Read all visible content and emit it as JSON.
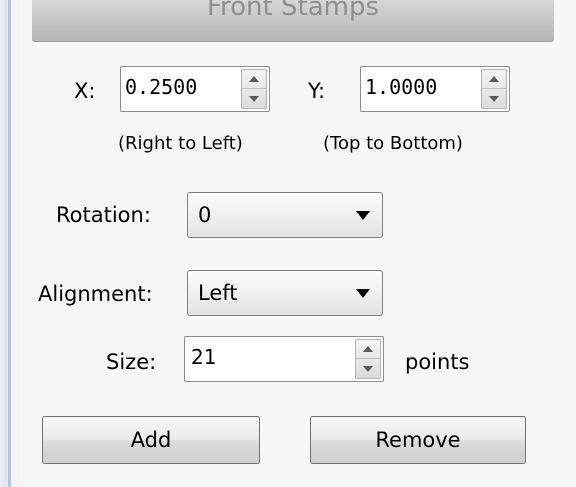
{
  "panel": {
    "title": "Front Stamps"
  },
  "position": {
    "x_label": "X:",
    "x_value": "0.2500",
    "x_hint": "(Right to Left)",
    "y_label": "Y:",
    "y_value": "1.0000",
    "y_hint": "(Top to Bottom)"
  },
  "rotation": {
    "label": "Rotation:",
    "value": "0"
  },
  "alignment": {
    "label": "Alignment:",
    "value": "Left"
  },
  "size": {
    "label": "Size:",
    "value": "21",
    "unit": "points"
  },
  "buttons": {
    "add": "Add",
    "remove": "Remove"
  }
}
